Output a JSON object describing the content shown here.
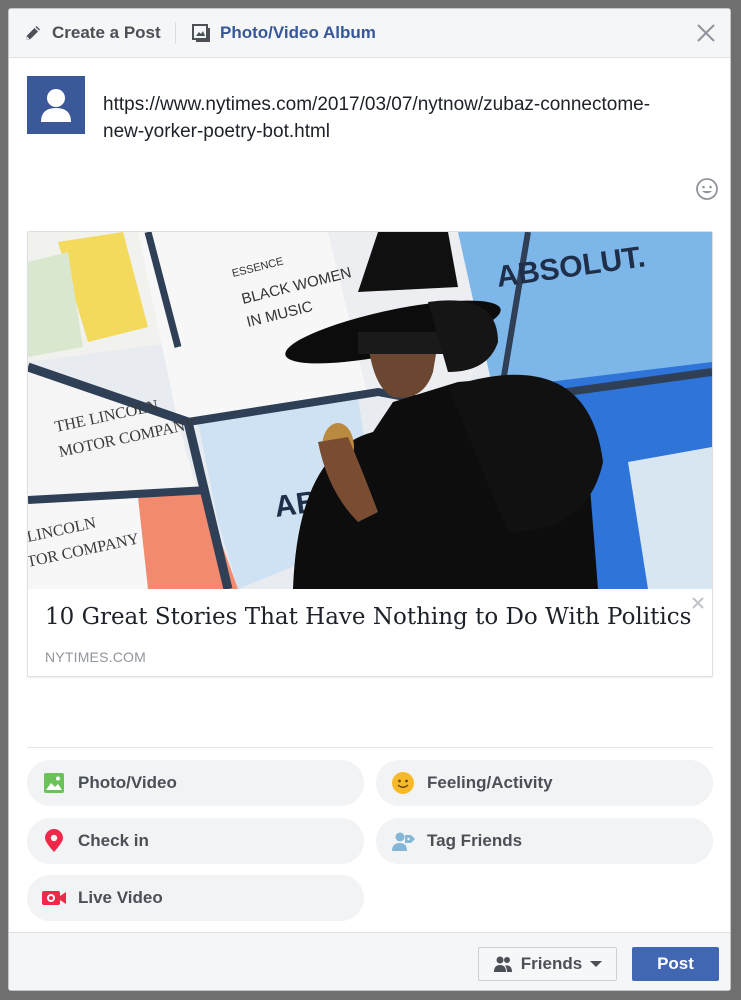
{
  "header": {
    "create_tab_label": "Create a Post",
    "album_tab_label": "Photo/Video Album"
  },
  "composer": {
    "text": "https://www.nytimes.com/2017/03/07/nytnow/zubaz-connectome-new-yorker-poetry-bot.html"
  },
  "link_preview": {
    "title": "10 Great Stories That Have Nothing to Do With Politics",
    "source": "NYTIMES.COM",
    "image_texts": {
      "brand_top": "ABSOLUT.",
      "brand_mid": "ABS",
      "essence": "ESSENCE",
      "black_women": "BLACK WOMEN",
      "in_music": "IN MUSIC",
      "lincoln_1": "THE LINCOLN",
      "lincoln_2": "MOTOR COMPANY",
      "lincoln_3": "LINCOLN",
      "lincoln_4": "TOR COMPANY"
    }
  },
  "actions": {
    "photo_video": "Photo/Video",
    "feeling_activity": "Feeling/Activity",
    "check_in": "Check in",
    "tag_friends": "Tag Friends",
    "live_video": "Live Video"
  },
  "footer": {
    "audience_label": "Friends",
    "post_label": "Post"
  },
  "colors": {
    "brand_blue": "#4267b2",
    "link_blue": "#365899",
    "avatar_blue": "#3b5998"
  }
}
